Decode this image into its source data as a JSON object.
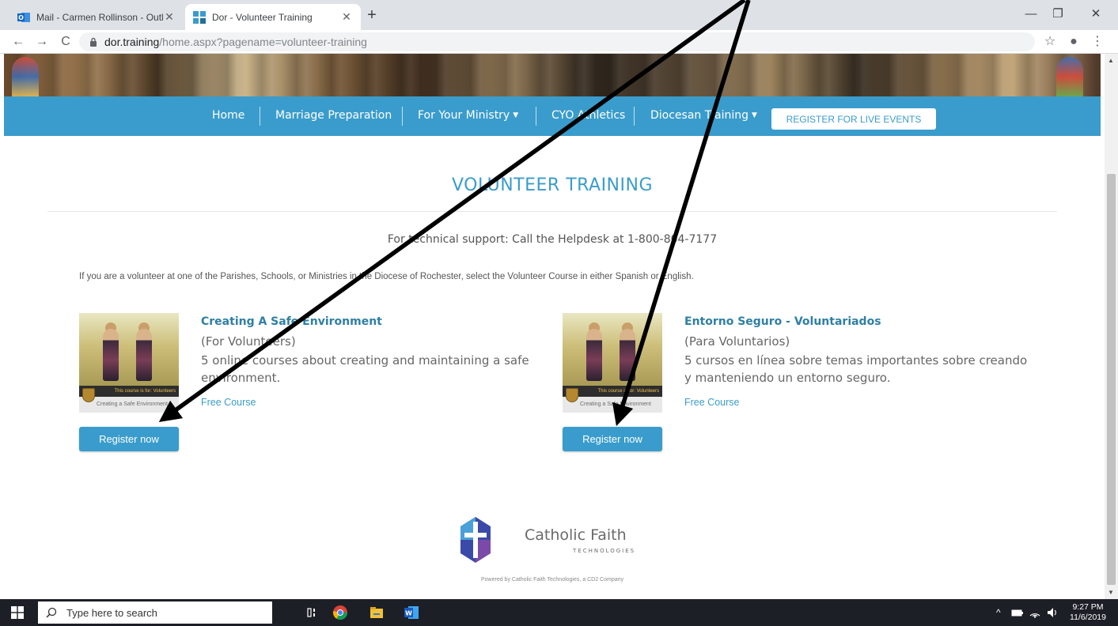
{
  "browser": {
    "tabs": [
      {
        "title": "Mail - Carmen Rollinson - Outloo",
        "active": false
      },
      {
        "title": "Dor - Volunteer Training",
        "active": true
      }
    ],
    "new_tab_label": "+",
    "url_host": "dor.training",
    "url_path": "/home.aspx?pagename=volunteer-training",
    "window_controls": {
      "minimize": "—",
      "restore": "❐",
      "close": "✕"
    },
    "nav": {
      "back": "←",
      "forward": "→",
      "reload": "C"
    },
    "toolbar_right": {
      "bookmark": "☆",
      "profile": "●",
      "menu": "⋮"
    }
  },
  "site": {
    "nav": [
      {
        "label": "Home"
      },
      {
        "label": "Marriage Preparation"
      },
      {
        "label": "For Your Ministry",
        "caret": "▼"
      },
      {
        "label": "CYO Athletics"
      },
      {
        "label": "Diocesan Training",
        "caret": "▼"
      }
    ],
    "register_events_label": "REGISTER FOR LIVE EVENTS",
    "accent_color": "#3a9ccc"
  },
  "page": {
    "title": "VOLUNTEER TRAINING",
    "support": "For technical support: Call the Helpdesk at 1-800-804-7177",
    "intro": "If you are a volunteer at one of the Parishes, Schools, or Ministries in the Diocese of Rochester, select the Volunteer Course in either Spanish or English.",
    "courses": [
      {
        "title": "Creating A Safe Environment",
        "subtitle": "(For Volunteers)",
        "description": "5 online courses about creating and maintaining a safe environment.",
        "price": "Free Course",
        "button": "Register now",
        "thumb_band": "This course is for: Volunteers",
        "thumb_foot": "Creating a Safe Environment"
      },
      {
        "title": "Entorno Seguro - Voluntariados",
        "subtitle": "(Para Voluntarios)",
        "description": "5 cursos en línea sobre temas importantes sobre creando y manteniendo un entorno seguro.",
        "price": "Free Course",
        "button": "Register now",
        "thumb_band": "This course is for: Volunteers",
        "thumb_foot": "Creating a Safe Environment"
      }
    ]
  },
  "footer": {
    "brand": "Catholic Faith",
    "tagline": "TECHNOLOGIES",
    "powered": "Powered by Catholic Faith Technologies, a CD2 Company"
  },
  "taskbar": {
    "search_placeholder": "Type here to search",
    "time": "9:27 PM",
    "date": "11/6/2019",
    "tray_caret": "^"
  }
}
